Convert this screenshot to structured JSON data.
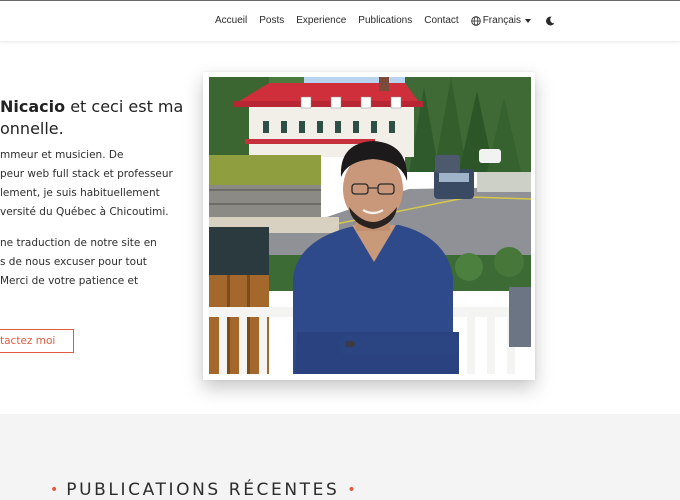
{
  "nav": {
    "items": [
      "Accueil",
      "Posts",
      "Experience",
      "Publications",
      "Contact"
    ],
    "language_label": "Français",
    "icons": [
      "globe-icon",
      "chevron-down-icon",
      "moon-icon"
    ]
  },
  "hero": {
    "title_bold": "Nicacio",
    "title_rest": " et ceci est ma",
    "title_line2": "onnelle.",
    "paragraph1": [
      "mmeur et musicien. De",
      "peur web full stack et professeur",
      "lement, je suis habituellement",
      "versité du Québec à Chicoutimi."
    ],
    "paragraph2": [
      "ne traduction de notre site en",
      "s de nous excuser pour tout",
      "Merci de votre patience et"
    ],
    "contact_button": "tactez moi"
  },
  "colors": {
    "accent": "#e05b42",
    "section_background": "#f4f4f4"
  },
  "section": {
    "title": "PUBLICATIONS RÉCENTES"
  }
}
